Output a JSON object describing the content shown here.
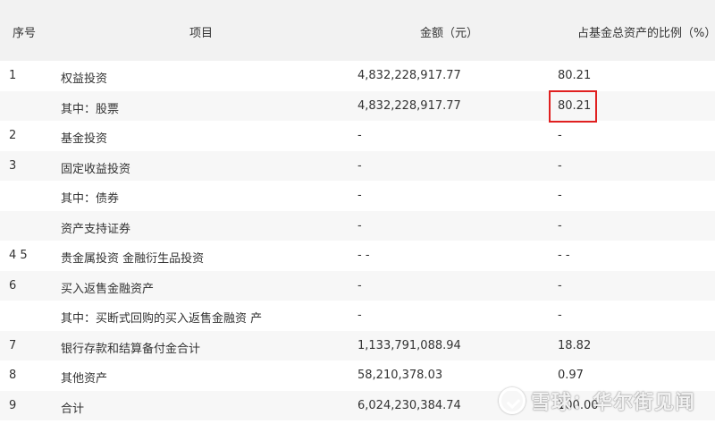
{
  "header": {
    "seq": "序号",
    "item": "项目",
    "amount": "金额（元）",
    "ratio": "占基金总资产的比例（%）"
  },
  "rows": [
    {
      "seq": "1",
      "item": "权益投资",
      "amount": "4,832,228,917.77",
      "ratio": "80.21"
    },
    {
      "seq": "",
      "item": "其中：股票",
      "amount": "4,832,228,917.77",
      "ratio": "80.21"
    },
    {
      "seq": "2",
      "item": "基金投资",
      "amount": "-",
      "ratio": "-"
    },
    {
      "seq": "3",
      "item": "固定收益投资",
      "amount": "-",
      "ratio": "-"
    },
    {
      "seq": "",
      "item": "其中：债券",
      "amount": "-",
      "ratio": "-"
    },
    {
      "seq": "",
      "item": "资产支持证券",
      "amount": "-",
      "ratio": "-"
    },
    {
      "seq": "4 5",
      "item": "贵金属投资 金融衍生品投资",
      "amount": "- -",
      "ratio": "- -"
    },
    {
      "seq": "6",
      "item": "买入返售金融资产",
      "amount": "-",
      "ratio": "-"
    },
    {
      "seq": "",
      "item": "其中：买断式回购的买入返售金融资 产",
      "amount": "-",
      "ratio": "-"
    },
    {
      "seq": "7",
      "item": "银行存款和结算备付金合计",
      "amount": "1,133,791,088.94",
      "ratio": "18.82"
    },
    {
      "seq": "8",
      "item": "其他资产",
      "amount": "58,210,378.03",
      "ratio": "0.97"
    },
    {
      "seq": "9",
      "item": "合计",
      "amount": "6,024,230,384.74",
      "ratio": "100.00"
    }
  ],
  "watermark": {
    "text": "雪球：华尔街见闻",
    "icon": "snowball-logo-icon"
  },
  "colors": {
    "header_bg": "#f2f2f2",
    "alt_row_bg": "#f7f7f7",
    "highlight_border": "#e02020",
    "text": "#333333"
  }
}
